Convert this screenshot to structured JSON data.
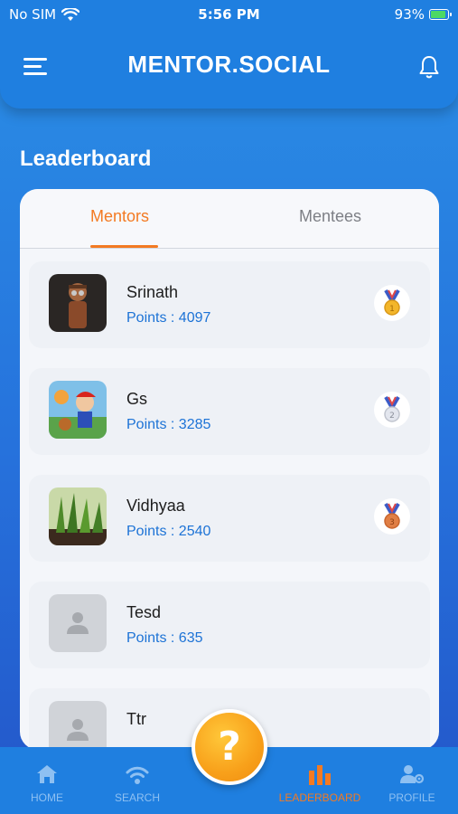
{
  "status_bar": {
    "carrier": "No SIM",
    "time": "5:56 PM",
    "battery": "93%"
  },
  "header": {
    "title": "MENTOR.SOCIAL",
    "menu_icon": "hamburger-icon",
    "bell_icon": "bell-icon"
  },
  "section": {
    "title": "Leaderboard"
  },
  "tabs": [
    {
      "label": "Mentors",
      "active": true
    },
    {
      "label": "Mentees",
      "active": false
    }
  ],
  "leaderboard": [
    {
      "name": "Srinath",
      "points": "Points : 4097",
      "medal": "gold",
      "medal_num": "1"
    },
    {
      "name": "Gs",
      "points": "Points : 3285",
      "medal": "silver",
      "medal_num": "2"
    },
    {
      "name": "Vidhyaa",
      "points": "Points : 2540",
      "medal": "bronze",
      "medal_num": "3"
    },
    {
      "name": "Tesd",
      "points": "Points : 635"
    },
    {
      "name": "Ttr"
    }
  ],
  "bottom_nav": [
    {
      "label": "HOME",
      "icon": "home-icon"
    },
    {
      "label": "SEARCH",
      "icon": "wifi-search-icon"
    },
    {
      "label": "LEADERBOARD",
      "icon": "bar-chart-icon",
      "active": true
    },
    {
      "label": "PROFILE",
      "icon": "profile-settings-icon"
    }
  ],
  "fab": {
    "label": "?",
    "icon": "question-icon"
  },
  "colors": {
    "primary": "#1f7fe0",
    "accent": "#f37a22",
    "points": "#1d73d6"
  }
}
